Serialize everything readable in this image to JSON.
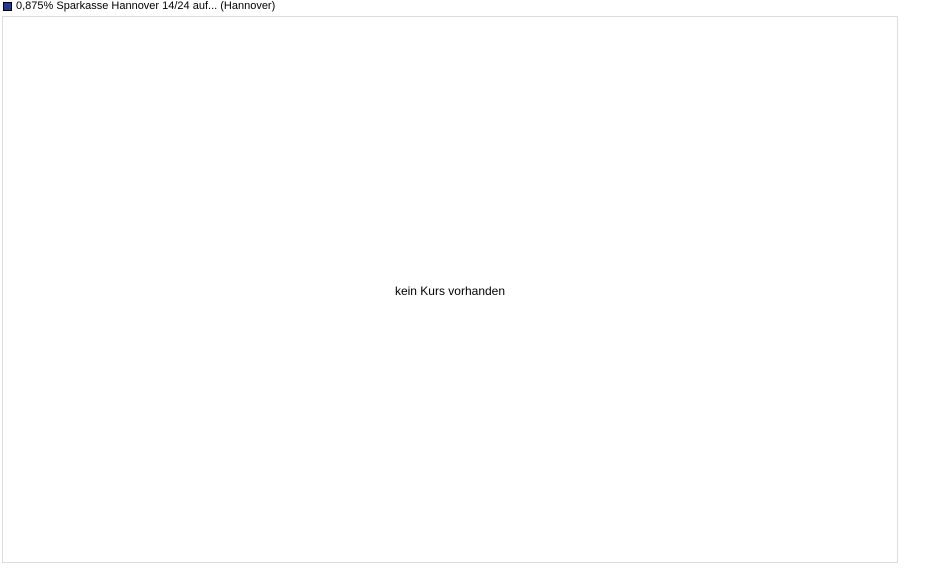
{
  "chart_data": {
    "type": "line",
    "series": [
      {
        "name": "0,875% Sparkasse Hannover 14/24 auf... (Hannover)",
        "color": "#1f3a93",
        "values": []
      }
    ],
    "message": "kein Kurs vorhanden",
    "legend_position": "top-left",
    "grid": false
  }
}
